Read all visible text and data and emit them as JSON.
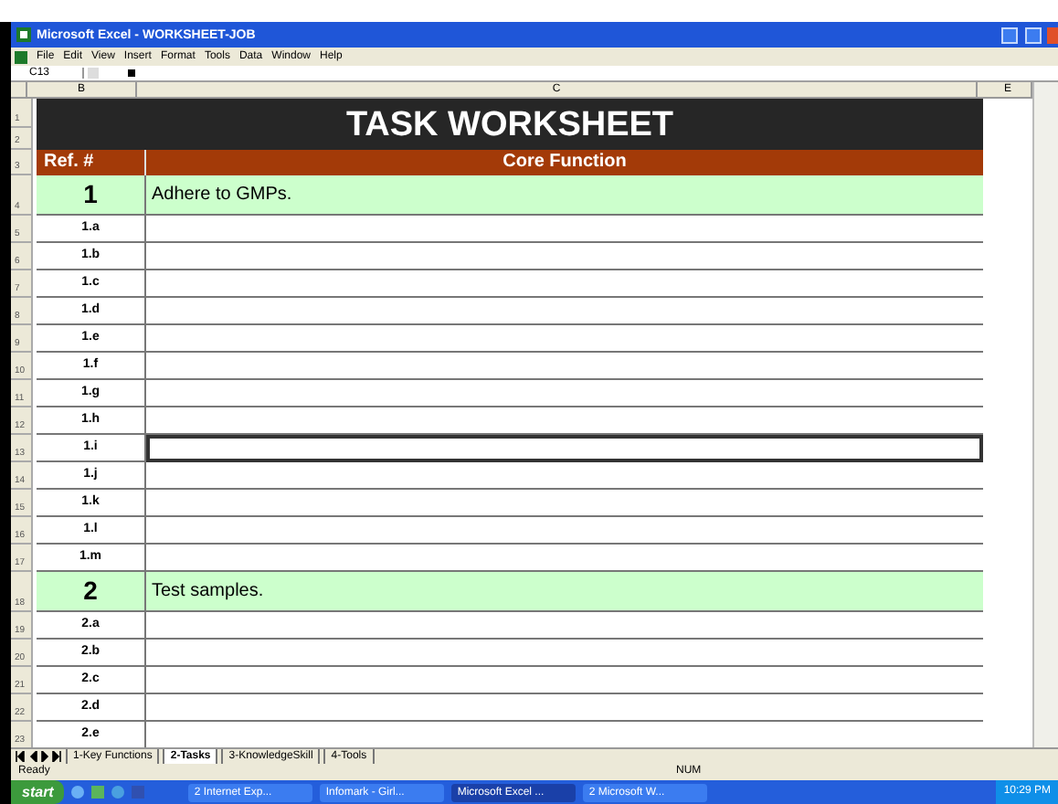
{
  "window": {
    "title": "Microsoft Excel - WORKSHEET-JOB"
  },
  "menu": [
    "File",
    "Edit",
    "View",
    "Insert",
    "Format",
    "Tools",
    "Data",
    "Window",
    "Help"
  ],
  "name_box": "C13",
  "columns": [
    "B",
    "C",
    "E"
  ],
  "sheet": {
    "title_rows": [
      "1",
      "2"
    ],
    "title": "TASK WORKSHEET",
    "header_row": "3",
    "header": [
      "Ref. #",
      "Core Function"
    ],
    "rows": [
      {
        "kind": "section",
        "row": "4",
        "ref": "1",
        "text": "Adhere to GMPs.",
        "selected": false
      },
      {
        "kind": "item",
        "row": "5",
        "ref": "1.a",
        "selected": false
      },
      {
        "kind": "item",
        "row": "6",
        "ref": "1.b",
        "selected": false
      },
      {
        "kind": "item",
        "row": "7",
        "ref": "1.c",
        "selected": false
      },
      {
        "kind": "item",
        "row": "8",
        "ref": "1.d",
        "selected": false
      },
      {
        "kind": "item",
        "row": "9",
        "ref": "1.e",
        "selected": false
      },
      {
        "kind": "item",
        "row": "10",
        "ref": "1.f",
        "selected": false
      },
      {
        "kind": "item",
        "row": "11",
        "ref": "1.g",
        "selected": false
      },
      {
        "kind": "item",
        "row": "12",
        "ref": "1.h",
        "selected": false
      },
      {
        "kind": "item",
        "row": "13",
        "ref": "1.i",
        "selected": true
      },
      {
        "kind": "item",
        "row": "14",
        "ref": "1.j",
        "selected": false
      },
      {
        "kind": "item",
        "row": "15",
        "ref": "1.k",
        "selected": false
      },
      {
        "kind": "item",
        "row": "16",
        "ref": "1.l",
        "selected": false
      },
      {
        "kind": "item",
        "row": "17",
        "ref": "1.m",
        "selected": false
      },
      {
        "kind": "section",
        "row": "18",
        "ref": "2",
        "text": "Test samples.",
        "selected": false
      },
      {
        "kind": "item",
        "row": "19",
        "ref": "2.a",
        "selected": false
      },
      {
        "kind": "item",
        "row": "20",
        "ref": "2.b",
        "selected": false
      },
      {
        "kind": "item",
        "row": "21",
        "ref": "2.c",
        "selected": false
      },
      {
        "kind": "item",
        "row": "22",
        "ref": "2.d",
        "selected": false
      },
      {
        "kind": "item",
        "row": "23",
        "ref": "2.e",
        "selected": false
      }
    ]
  },
  "sheet_tabs": [
    {
      "label": "1-Key Functions",
      "selected": false
    },
    {
      "label": "2-Tasks",
      "selected": true
    },
    {
      "label": "3-KnowledgeSkill",
      "selected": false
    },
    {
      "label": "4-Tools",
      "selected": false
    }
  ],
  "status_bar": {
    "status": "Ready",
    "indicator": "NUM"
  },
  "taskbar": {
    "start": "start",
    "items": [
      {
        "label": "2 Internet Exp...",
        "selected": false
      },
      {
        "label": "Infomark - Girl...",
        "selected": false
      },
      {
        "label": "Microsoft Excel ...",
        "selected": true
      },
      {
        "label": "2 Microsoft W...",
        "selected": false
      }
    ],
    "clock": "10:29 PM"
  }
}
